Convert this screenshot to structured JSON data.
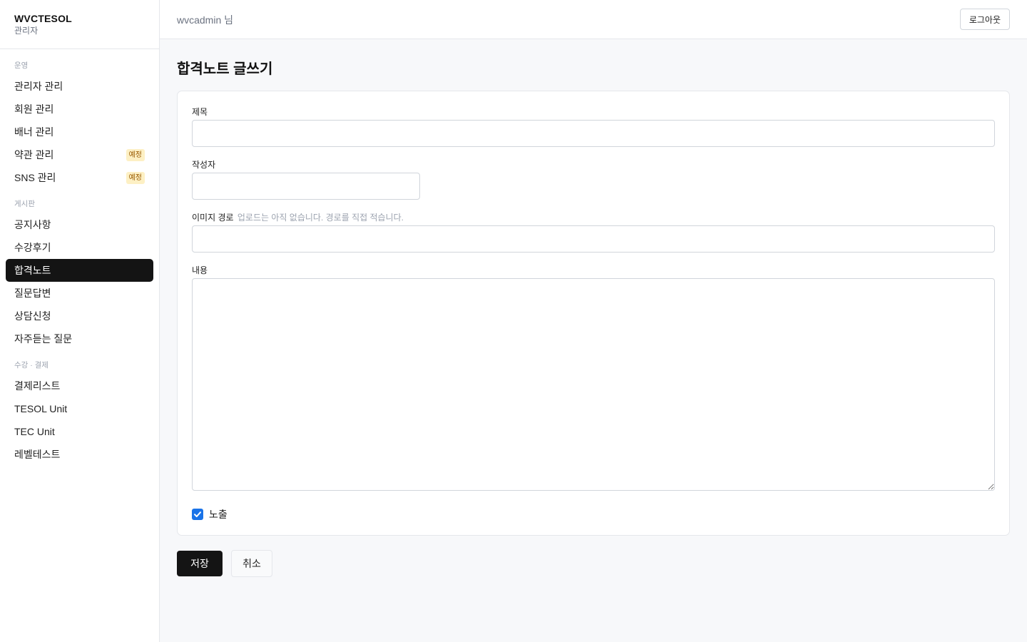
{
  "brand": {
    "name": "WVCTESOL",
    "subtitle": "관리자"
  },
  "sidebar": {
    "groups": [
      {
        "label": "운영",
        "items": [
          {
            "label": "관리자 관리"
          },
          {
            "label": "회원 관리"
          },
          {
            "label": "배너 관리"
          },
          {
            "label": "약관 관리",
            "badge": "예정"
          },
          {
            "label": "SNS 관리",
            "badge": "예정"
          }
        ]
      },
      {
        "label": "게시판",
        "items": [
          {
            "label": "공지사항"
          },
          {
            "label": "수강후기"
          },
          {
            "label": "합격노트",
            "active": true
          },
          {
            "label": "질문답변"
          },
          {
            "label": "상담신청"
          },
          {
            "label": "자주듣는 질문"
          }
        ]
      },
      {
        "label": "수강 · 결제",
        "items": [
          {
            "label": "결제리스트"
          },
          {
            "label": "TESOL Unit"
          },
          {
            "label": "TEC Unit"
          },
          {
            "label": "레벨테스트"
          }
        ]
      }
    ]
  },
  "header": {
    "user_label": "wvcadmin 님",
    "logout_label": "로그아웃"
  },
  "page": {
    "title": "합격노트 글쓰기"
  },
  "form": {
    "title_label": "제목",
    "title_value": "",
    "author_label": "작성자",
    "author_value": "",
    "image_label": "이미지 경로",
    "image_hint": "업로드는 아직 없습니다. 경로를 직접 적습니다.",
    "image_value": "",
    "content_label": "내용",
    "content_value": "",
    "visible_label": "노출",
    "visible_checked": true
  },
  "actions": {
    "save_label": "저장",
    "cancel_label": "취소"
  },
  "colors": {
    "accent": "#141414",
    "checkbox": "#1a73e8",
    "badge_bg": "#fdf0c4",
    "badge_text": "#9a5a00"
  }
}
